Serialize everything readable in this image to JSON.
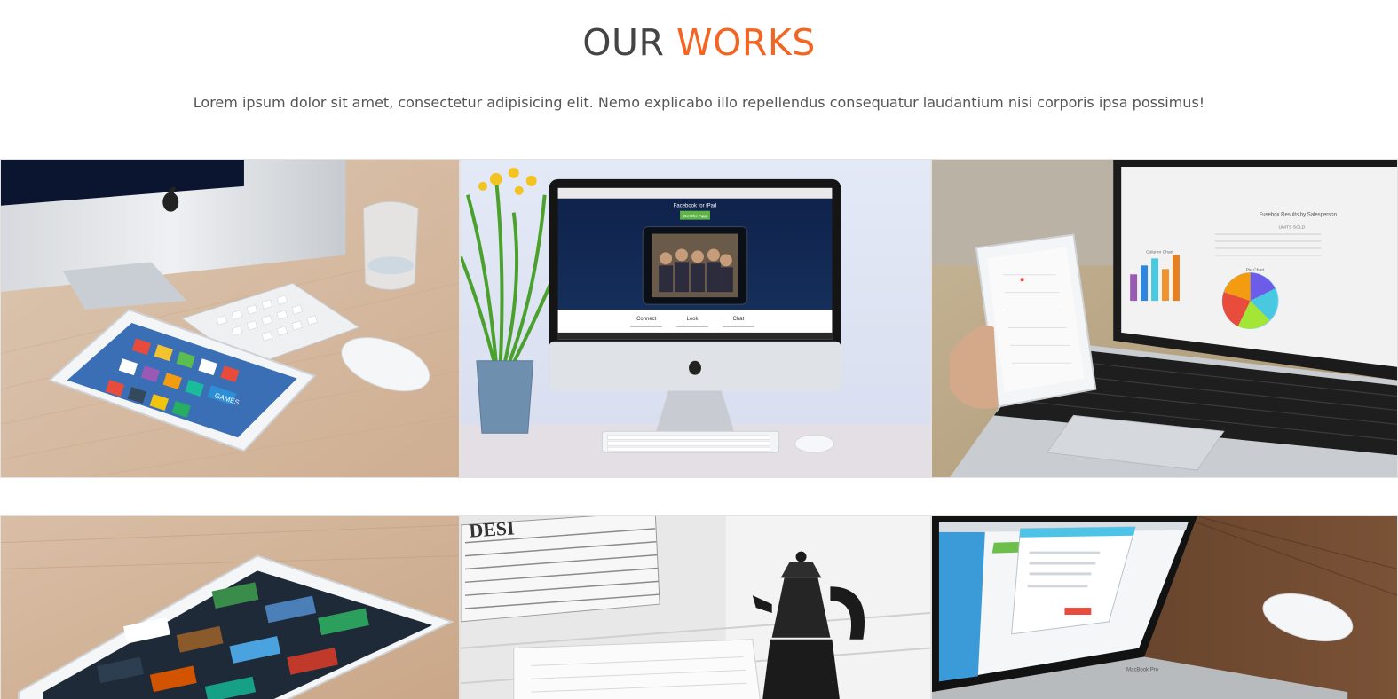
{
  "section": {
    "title_part_a": "OUR",
    "title_part_b": "WORKS",
    "intro": "Lorem ipsum dolor sit amet, consectetur adipisicing elit. Nemo explicabo illo repellendus consequatur laudantium nisi corporis ipsa possimus!"
  },
  "colors": {
    "accent": "#f26522",
    "heading": "#444444",
    "text": "#555555"
  },
  "portfolio": {
    "items": [
      {
        "thumb": "imac-keyboard-tablet-photo"
      },
      {
        "thumb": "imac-facebook-screen-photo"
      },
      {
        "thumb": "laptop-charts-tablet-photo"
      },
      {
        "thumb": "ipad-on-table-photo"
      },
      {
        "thumb": "coffee-pot-magazines-photo"
      },
      {
        "thumb": "macbook-web-app-photo"
      }
    ],
    "imac_screen": {
      "heading": "Facebook for iPad",
      "cta": "Get the App",
      "columns": [
        "Connect",
        "Look",
        "Chat"
      ]
    },
    "laptop_screen": {
      "report_title": "Fusebox Results by Salesperson",
      "chart_titles": [
        "Column Chart",
        "Pie Chart"
      ],
      "table_header": "UNITS SOLD"
    },
    "tablet_screen": {
      "tile_label": "GAMES"
    },
    "magazine_text": "DESI",
    "laptop_model": "MacBook Pro"
  }
}
